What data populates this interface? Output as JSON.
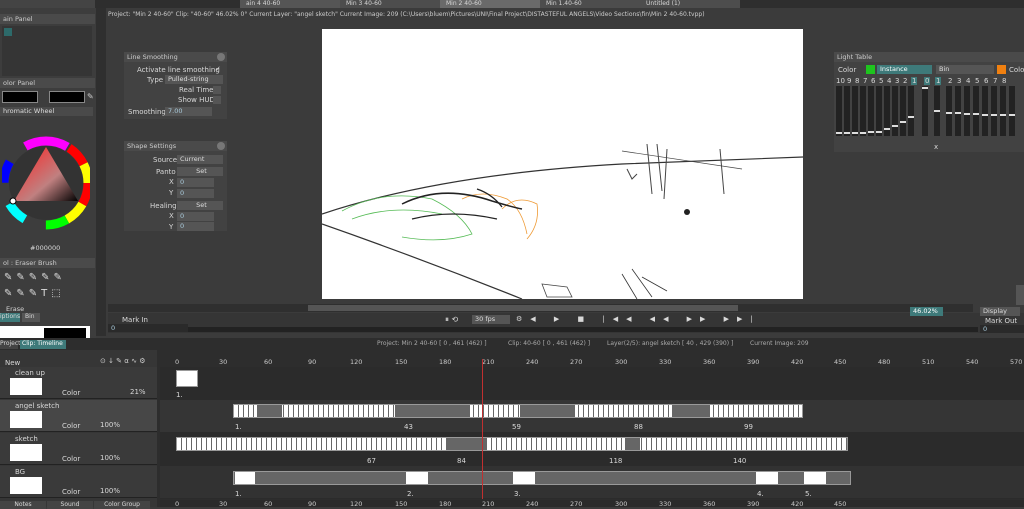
{
  "colors": {
    "accent_red": "#c03030",
    "green_swatch": "#1ec51e",
    "orange_swatch": "#f08010",
    "teal": "#3e7a7a",
    "canvas_bg": "#ffffff"
  },
  "tabs": [
    "ain 4 40-60",
    "Min 3 40-60",
    "Min 2 40-60",
    "Min 1.40-60",
    "Untitled (1)"
  ],
  "status_line": "Project: \"Min 2 40-60\"  Clip: \"40-60\"  46.02%  0°  Current Layer: \"angel sketch\"  Current Image: 209  (C:\\Users\\bluem\\Pictures\\UNI\\Final Project\\DISTASTEFUL ANGELS\\Video Sections\\fin\\Min 2 40-60.tvpp)",
  "left_panels": {
    "main_panel_title": "ain Panel",
    "color_panel_title": "olor Panel",
    "wheel_mode": "hromatic Wheel",
    "hex_value": "#000000",
    "tool_title": "ol : Eraser Brush",
    "erase_label": "Erase",
    "options_tab": "iptions",
    "bin_tab": "Bin"
  },
  "line_smoothing": {
    "title": "Line Smoothing",
    "activate_label": "Activate line smoothing",
    "activate_check": "✓",
    "type_label": "Type",
    "type_value": "Pulled-string",
    "realtime_label": "Real Time",
    "showhud_label": "Show HUD",
    "smoothing_label": "Smoothing",
    "smoothing_value": "7.00"
  },
  "shape_settings": {
    "title": "Shape Settings",
    "source_label": "Source",
    "source_value": "Current",
    "panto_label": "Panto",
    "set_label": "Set",
    "x_label": "X",
    "y_label": "Y",
    "zero": "0",
    "healing_label": "Healing"
  },
  "light_table": {
    "title": "Light Table",
    "color_label": "Color",
    "instance_label": "Instance",
    "bin_label": "Bin",
    "color_label2": "Colo",
    "numbers_left": [
      "10",
      "9",
      "8",
      "7",
      "6",
      "5",
      "4",
      "3",
      "2",
      "1",
      "0"
    ],
    "numbers_right": [
      "1",
      "2",
      "3",
      "4",
      "5",
      "6",
      "7",
      "8"
    ],
    "x_label": "x"
  },
  "transport": {
    "mark_in_label": "Mark In",
    "mark_in_value": "0",
    "fps": "30 fps",
    "zoom": "46.02%",
    "display_label": "Display",
    "mark_out_label": "Mark Out",
    "mark_out_value": "0"
  },
  "timeline": {
    "project_tab": "Project",
    "clip_tab": "Clip: Timeline",
    "info_project": "Project: Min 2 40-60  [ 0 , 461  (462) ]",
    "info_clip": "Clip: 40-60  [ 0 , 461  (462) ]",
    "info_layer": "Layer(2/5): angel sketch  [ 40 , 429  (390) ]",
    "info_image": "Current Image: 209",
    "ruler": [
      "0",
      "30",
      "60",
      "90",
      "120",
      "150",
      "180",
      "210",
      "240",
      "270",
      "300",
      "330",
      "360",
      "390",
      "420",
      "450",
      "480",
      "510",
      "540",
      "570"
    ],
    "new_label": "New",
    "layers": [
      {
        "name": "clean up",
        "color_label": "Color",
        "opacity": "21%",
        "marks": [
          "1."
        ]
      },
      {
        "name": "angel sketch",
        "color_label": "Color",
        "opacity": "100%",
        "marks": [
          "1.",
          "43",
          "59",
          "88",
          "99"
        ]
      },
      {
        "name": "sketch",
        "color_label": "Color",
        "opacity": "100%",
        "marks": [
          "67",
          "84",
          "118",
          "140"
        ]
      },
      {
        "name": "BG",
        "color_label": "Color",
        "opacity": "100%",
        "marks": [
          "1.",
          "2.",
          "3.",
          "4.",
          "5."
        ]
      }
    ],
    "bottom_tabs": [
      "Notes",
      "Sound",
      "Color Group"
    ]
  }
}
